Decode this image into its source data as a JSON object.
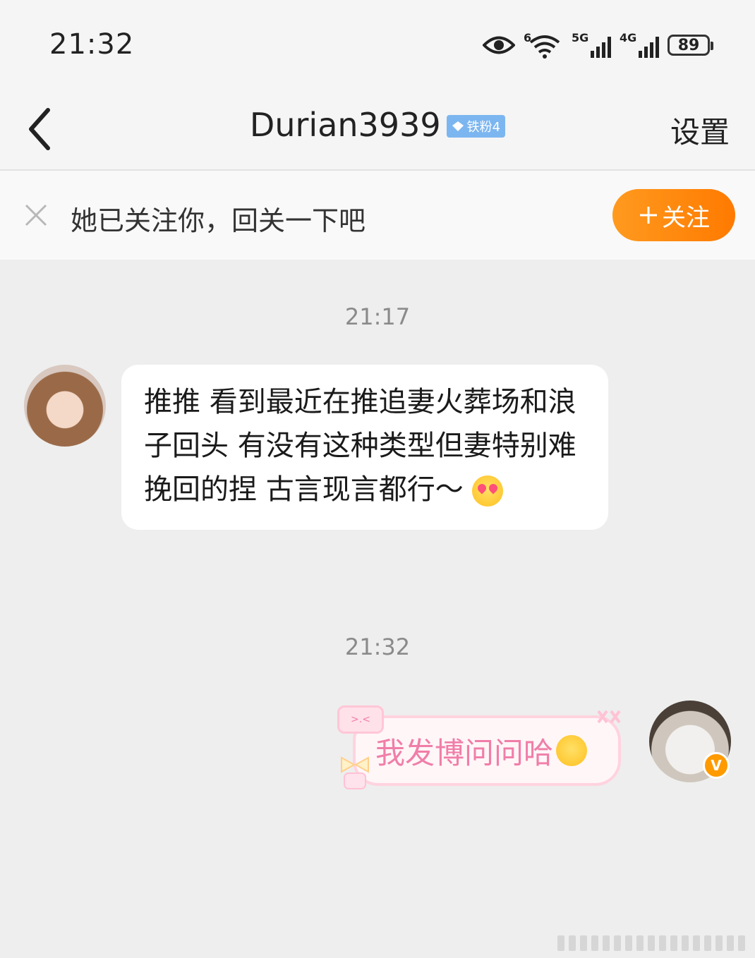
{
  "status": {
    "time": "21:32",
    "battery": "89",
    "wifi_label": "6",
    "sig1_label": "5G",
    "sig2_label": "4G"
  },
  "header": {
    "title": "Durian3939",
    "badge": "铁粉4",
    "settings": "设置"
  },
  "follow_bar": {
    "text": "她已关注你，回关一下吧",
    "button": "关注"
  },
  "messages": {
    "ts1": "21:17",
    "msg1": "推推 看到最近在推追妻火葬场和浪子回头 有没有这种类型但妻特别难挽回的捏 古言现言都行～",
    "ts2": "21:32",
    "msg2": "我发博问问哈",
    "bubble_tag": ">.<"
  },
  "colors": {
    "accent_orange": "#ff8a00",
    "badge_blue": "#7cb6f0",
    "pink_text": "#f07ea8"
  }
}
